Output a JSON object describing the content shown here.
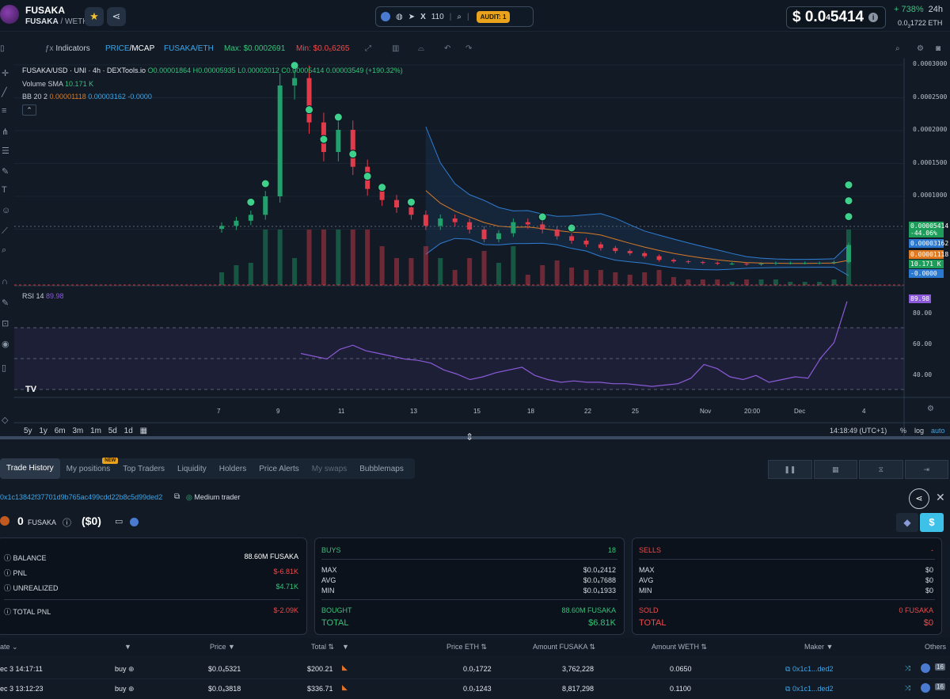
{
  "header": {
    "token_name": "FUSAKA",
    "pair_base": "FUSAKA",
    "pair_quote": "WETH",
    "social_count": "110",
    "audit_label": "AUDIT: 1",
    "price_prefix": "$ 0.0",
    "price_sub": "4",
    "price_main": "5414",
    "change_24h": "+ 738%",
    "change_period": "24h",
    "price_eth_prefix": "0.0",
    "price_eth_sub": "3",
    "price_eth_main": "1722",
    "price_eth_unit": "ETH"
  },
  "toolbar": {
    "indicators": "Indicators",
    "price_mcap_a": "PRICE",
    "price_mcap_b": "/MCAP",
    "pair_toggle": "FUSAKA/ETH",
    "max_label": "Max: $0.0002691",
    "min_label": "Min: $0.0₅6265"
  },
  "chart_data": [
    {
      "type": "candlestick",
      "title": "FUSAKA/USD · UNI · 4h · DEXTools.io",
      "ohlc_text": {
        "o": "0.00001864",
        "h": "0.00005935",
        "l": "0.00002012",
        "c": "0.00005414",
        "change": "0.00003549 (+190.32%)"
      },
      "volume_sma_label": "Volume SMA",
      "volume_sma_value": "10.171 K",
      "bb_label": "BB 20 2",
      "bb_values": [
        "0.00001118",
        "0.00003162",
        "-0.0000"
      ],
      "y_ticks": [
        "0.0003000",
        "0.0002500",
        "0.0002000",
        "0.0001500",
        "0.0001000"
      ],
      "x_ticks": [
        "7",
        "9",
        "11",
        "13",
        "15",
        "18",
        "22",
        "25",
        "Nov",
        "20:00",
        "Dec",
        "4"
      ],
      "price_tags": [
        "0.00005414",
        "-44.06%",
        "0.00003162",
        "0.00001118",
        "10.171 K",
        "-0.0000"
      ],
      "ylim": [
        0,
        0.0003
      ],
      "close_path": [
        8e-05,
        8.7e-05,
        9.5e-05,
        0.00012,
        0.00027,
        0.00028,
        0.00022,
        0.00018,
        0.00021,
        0.00016,
        0.00013,
        0.000115,
        0.000105,
        9.5e-05,
        8e-05,
        9e-05,
        8.5e-05,
        7.5e-05,
        6.2e-05,
        7e-05,
        8.5e-05,
        8.2e-05,
        7.5e-05,
        6.6e-05,
        6e-05,
        5.5e-05,
        5e-05,
        4.6e-05,
        4.3e-05,
        3.9e-05,
        3.4e-05,
        3.2e-05,
        3.1e-05,
        3e-05,
        2.9e-05,
        2.9e-05,
        2.8e-05,
        2.9e-05,
        3e-05,
        3e-05,
        3e-05,
        3e-05,
        3.1e-05,
        5.4e-05
      ]
    },
    {
      "type": "line",
      "title": "RSI 14",
      "value_label": "89.98",
      "y_ticks": [
        "80.00",
        "60.00",
        "40.00"
      ],
      "ylim": [
        20,
        95
      ],
      "values": [
        52,
        50,
        48,
        55,
        58,
        54,
        52,
        50,
        48,
        47,
        45,
        40,
        37,
        33,
        35,
        38,
        40,
        42,
        36,
        33,
        31,
        32,
        31,
        31,
        30,
        30,
        29,
        28,
        29,
        30,
        34,
        44,
        41,
        35,
        33,
        36,
        31,
        33,
        35,
        34,
        49,
        60,
        90
      ]
    }
  ],
  "chart_bottom": {
    "ranges": [
      "5y",
      "1y",
      "6m",
      "3m",
      "1m",
      "5d",
      "1d"
    ],
    "time": "14:18:49 (UTC+1)",
    "pct": "%",
    "log": "log",
    "auto": "auto"
  },
  "tabs": [
    "Trade History",
    "My positions",
    "Top Traders",
    "Liquidity",
    "Holders",
    "Price Alerts",
    "My swaps",
    "Bubblemaps"
  ],
  "tab_new_badge": "NEW",
  "wallet": {
    "address": "0x1c13842f37701d9b765ac499cdd22b8c5d99ded2",
    "trader_label": "Medium trader",
    "token_amount": "0",
    "token_symbol": "FUSAKA",
    "usd_value": "($0)"
  },
  "summary": {
    "balance_label": "BALANCE",
    "balance_value": "88.60M FUSAKA",
    "pnl_label": "PNL",
    "pnl_value": "$-6.81K",
    "unrealized_label": "UNREALIZED",
    "unrealized_value": "$4.71K",
    "total_pnl_label": "TOTAL PNL",
    "total_pnl_value": "$-2.09K"
  },
  "buys": {
    "title": "BUYS",
    "count": "18",
    "max_label": "MAX",
    "max_value": "$0.0₄2412",
    "avg_label": "AVG",
    "avg_value": "$0.0₄7688",
    "min_label": "MIN",
    "min_value": "$0.0₄1933",
    "bought_label": "BOUGHT",
    "bought_value": "88.60M FUSAKA",
    "total_label": "TOTAL",
    "total_value": "$6.81K"
  },
  "sells": {
    "title": "SELLS",
    "count": "-",
    "max_label": "MAX",
    "max_value": "$0",
    "avg_label": "AVG",
    "avg_value": "$0",
    "min_label": "MIN",
    "min_value": "$0",
    "sold_label": "SOLD",
    "sold_value": "0 FUSAKA",
    "total_label": "TOTAL",
    "total_value": "$0"
  },
  "table": {
    "headers": [
      "ate",
      "Price",
      "Total",
      "Price ETH",
      "Amount FUSAKA",
      "Amount WETH",
      "Maker",
      "Others"
    ],
    "rows": [
      {
        "date": "ec 3 14:17:11",
        "type": "buy",
        "price": "$0.0₄5321",
        "total": "$200.21",
        "price_eth": "0.0₇1722",
        "amount": "3,762,228",
        "weth": "0.0650",
        "maker": "0x1c1...ded2",
        "count": "16"
      },
      {
        "date": "ec 3 13:12:23",
        "type": "buy",
        "price": "$0.0₄3818",
        "total": "$336.71",
        "price_eth": "0.0₇1243",
        "amount": "8,817,298",
        "weth": "0.1100",
        "maker": "0x1c1...ded2",
        "count": "16"
      }
    ]
  }
}
